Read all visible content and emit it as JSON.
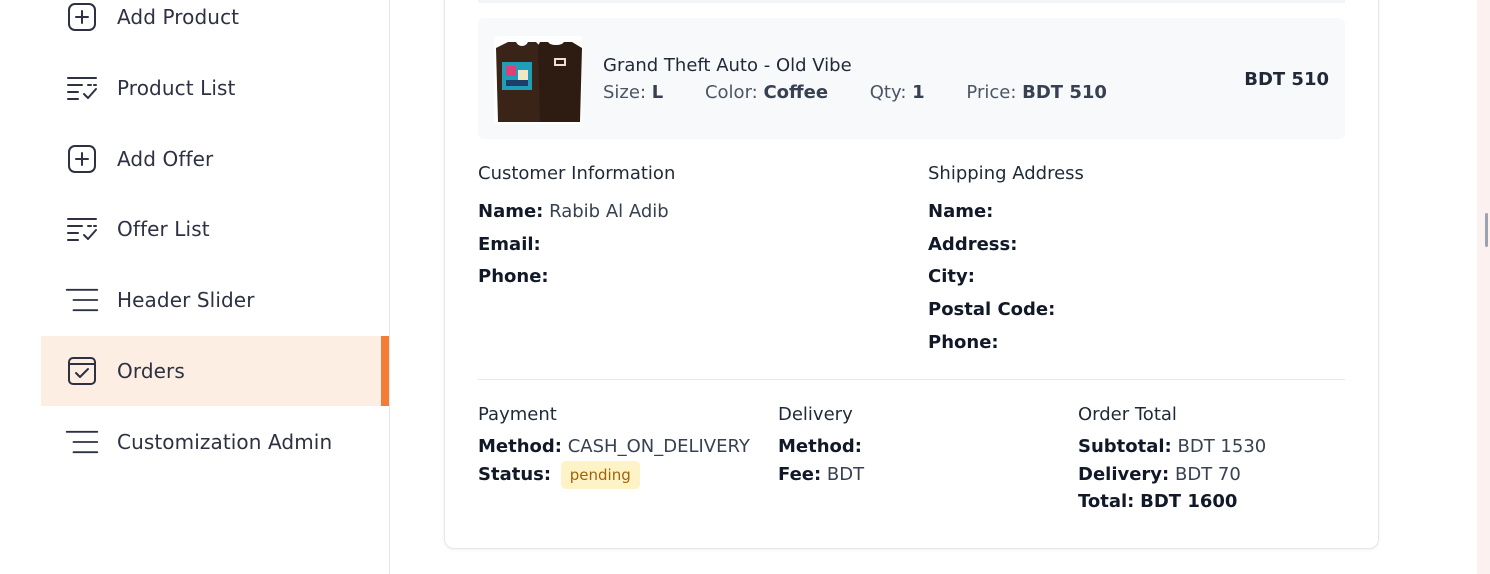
{
  "sidebar": {
    "items": [
      {
        "label": "Add Product",
        "icon": "plus-square-icon",
        "active": false
      },
      {
        "label": "Product List",
        "icon": "list-check-icon",
        "active": false
      },
      {
        "label": "Add Offer",
        "icon": "plus-square-icon",
        "active": false
      },
      {
        "label": "Offer List",
        "icon": "list-check-icon",
        "active": false
      },
      {
        "label": "Header Slider",
        "icon": "menu-lines-icon",
        "active": false
      },
      {
        "label": "Orders",
        "icon": "checkbox-square-icon",
        "active": true
      },
      {
        "label": "Customization Admin",
        "icon": "menu-lines-icon",
        "active": false
      }
    ],
    "accent_color": "#f47c34",
    "active_bg": "#fdeee4"
  },
  "order": {
    "item": {
      "title": "Grand Theft Auto - Old Vibe",
      "size_label": "Size:",
      "size": "L",
      "color_label": "Color:",
      "color": "Coffee",
      "qty_label": "Qty:",
      "qty": "1",
      "price_label": "Price:",
      "price": "BDT 510",
      "line_total": "BDT 510"
    },
    "customer": {
      "title": "Customer Information",
      "name_label": "Name:",
      "name": "Rabib Al Adib",
      "email_label": "Email:",
      "email": "",
      "phone_label": "Phone:",
      "phone": ""
    },
    "shipping": {
      "title": "Shipping Address",
      "name_label": "Name:",
      "address_label": "Address:",
      "city_label": "City:",
      "postal_label": "Postal Code:",
      "phone_label": "Phone:"
    },
    "payment": {
      "title": "Payment",
      "method_label": "Method:",
      "method": "CASH_ON_DELIVERY",
      "status_label": "Status:",
      "status": "pending"
    },
    "delivery": {
      "title": "Delivery",
      "method_label": "Method:",
      "method": "",
      "fee_label": "Fee:",
      "fee": "BDT"
    },
    "totals": {
      "title": "Order Total",
      "subtotal_label": "Subtotal:",
      "subtotal": "BDT 1530",
      "delivery_label": "Delivery:",
      "delivery": "BDT 70",
      "total_label": "Total:",
      "total": "BDT 1600"
    }
  }
}
